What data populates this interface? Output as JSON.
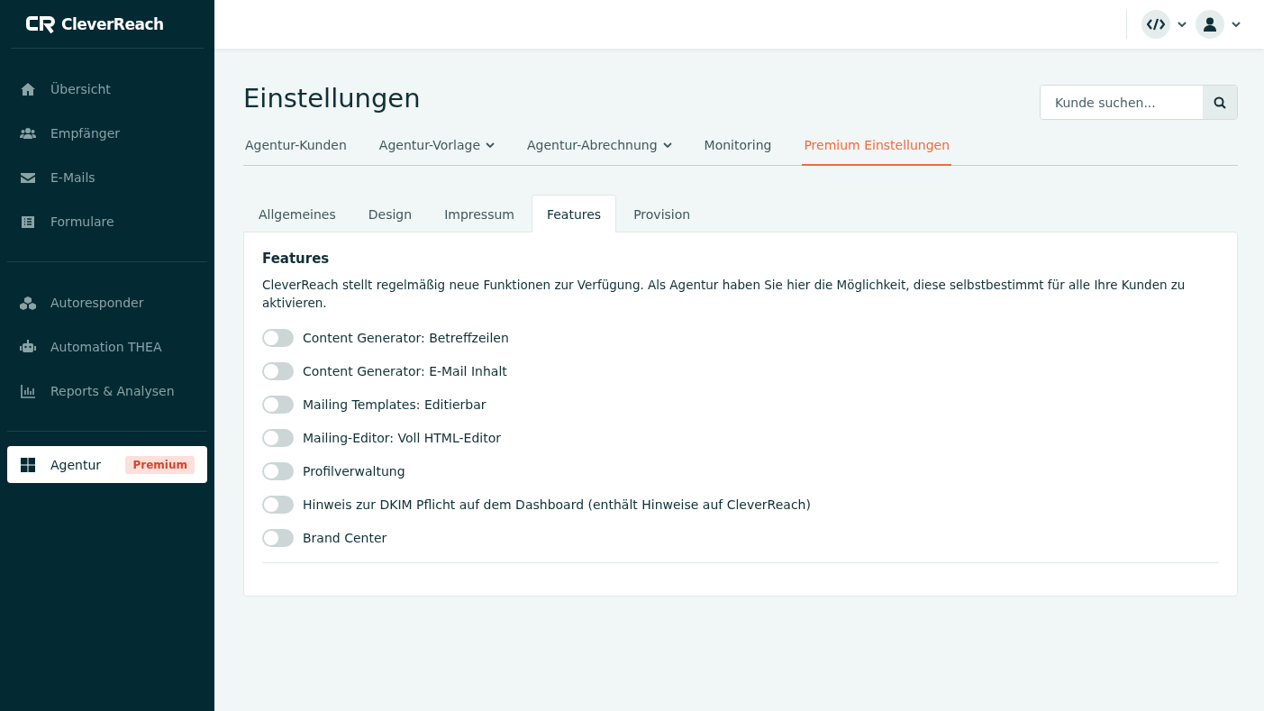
{
  "sidebar": {
    "logo": "CleverReach",
    "groups": [
      [
        {
          "label": "Übersicht",
          "selected": false
        },
        {
          "label": "Empfänger",
          "selected": false
        },
        {
          "label": "E-Mails",
          "selected": false
        },
        {
          "label": "Formulare",
          "selected": false
        }
      ],
      [
        {
          "label": "Autoresponder",
          "selected": false
        },
        {
          "label": "Automation THEA",
          "selected": false
        },
        {
          "label": "Reports & Analysen",
          "selected": false
        }
      ],
      [
        {
          "label": "Agentur",
          "selected": true,
          "badge": "Premium"
        }
      ]
    ]
  },
  "page": {
    "title": "Einstellungen",
    "search": {
      "placeholder": "Kunde suchen..."
    },
    "nav": [
      {
        "label": "Agentur-Kunden",
        "dropdown": false,
        "selected": false
      },
      {
        "label": "Agentur-Vorlage",
        "dropdown": true,
        "selected": false
      },
      {
        "label": "Agentur-Abrechnung",
        "dropdown": true,
        "selected": false
      },
      {
        "label": "Monitoring",
        "dropdown": false,
        "selected": false
      },
      {
        "label": "Premium Einstellungen",
        "dropdown": false,
        "selected": true
      }
    ],
    "tabs": [
      {
        "label": "Allgemeines",
        "selected": false
      },
      {
        "label": "Design",
        "selected": false
      },
      {
        "label": "Impressum",
        "selected": false
      },
      {
        "label": "Features",
        "selected": true
      },
      {
        "label": "Provision",
        "selected": false
      }
    ],
    "panel": {
      "heading": "Features",
      "description": "CleverReach stellt regelmäßig neue Funktionen zur Verfügung. Als Agentur haben Sie hier die Möglichkeit, diese selbstbestimmt für alle Ihre Kunden zu aktivieren.",
      "features": [
        {
          "label": "Content Generator: Betreffzeilen",
          "on": false
        },
        {
          "label": "Content Generator: E-Mail Inhalt",
          "on": false
        },
        {
          "label": "Mailing Templates: Editierbar",
          "on": false
        },
        {
          "label": "Mailing-Editor: Voll HTML-Editor",
          "on": false
        },
        {
          "label": "Profilverwaltung",
          "on": false
        },
        {
          "label": "Hinweis zur DKIM Pflicht auf dem Dashboard (enthält Hinweise auf CleverReach)",
          "on": false
        },
        {
          "label": "Brand Center",
          "on": false
        }
      ]
    }
  }
}
